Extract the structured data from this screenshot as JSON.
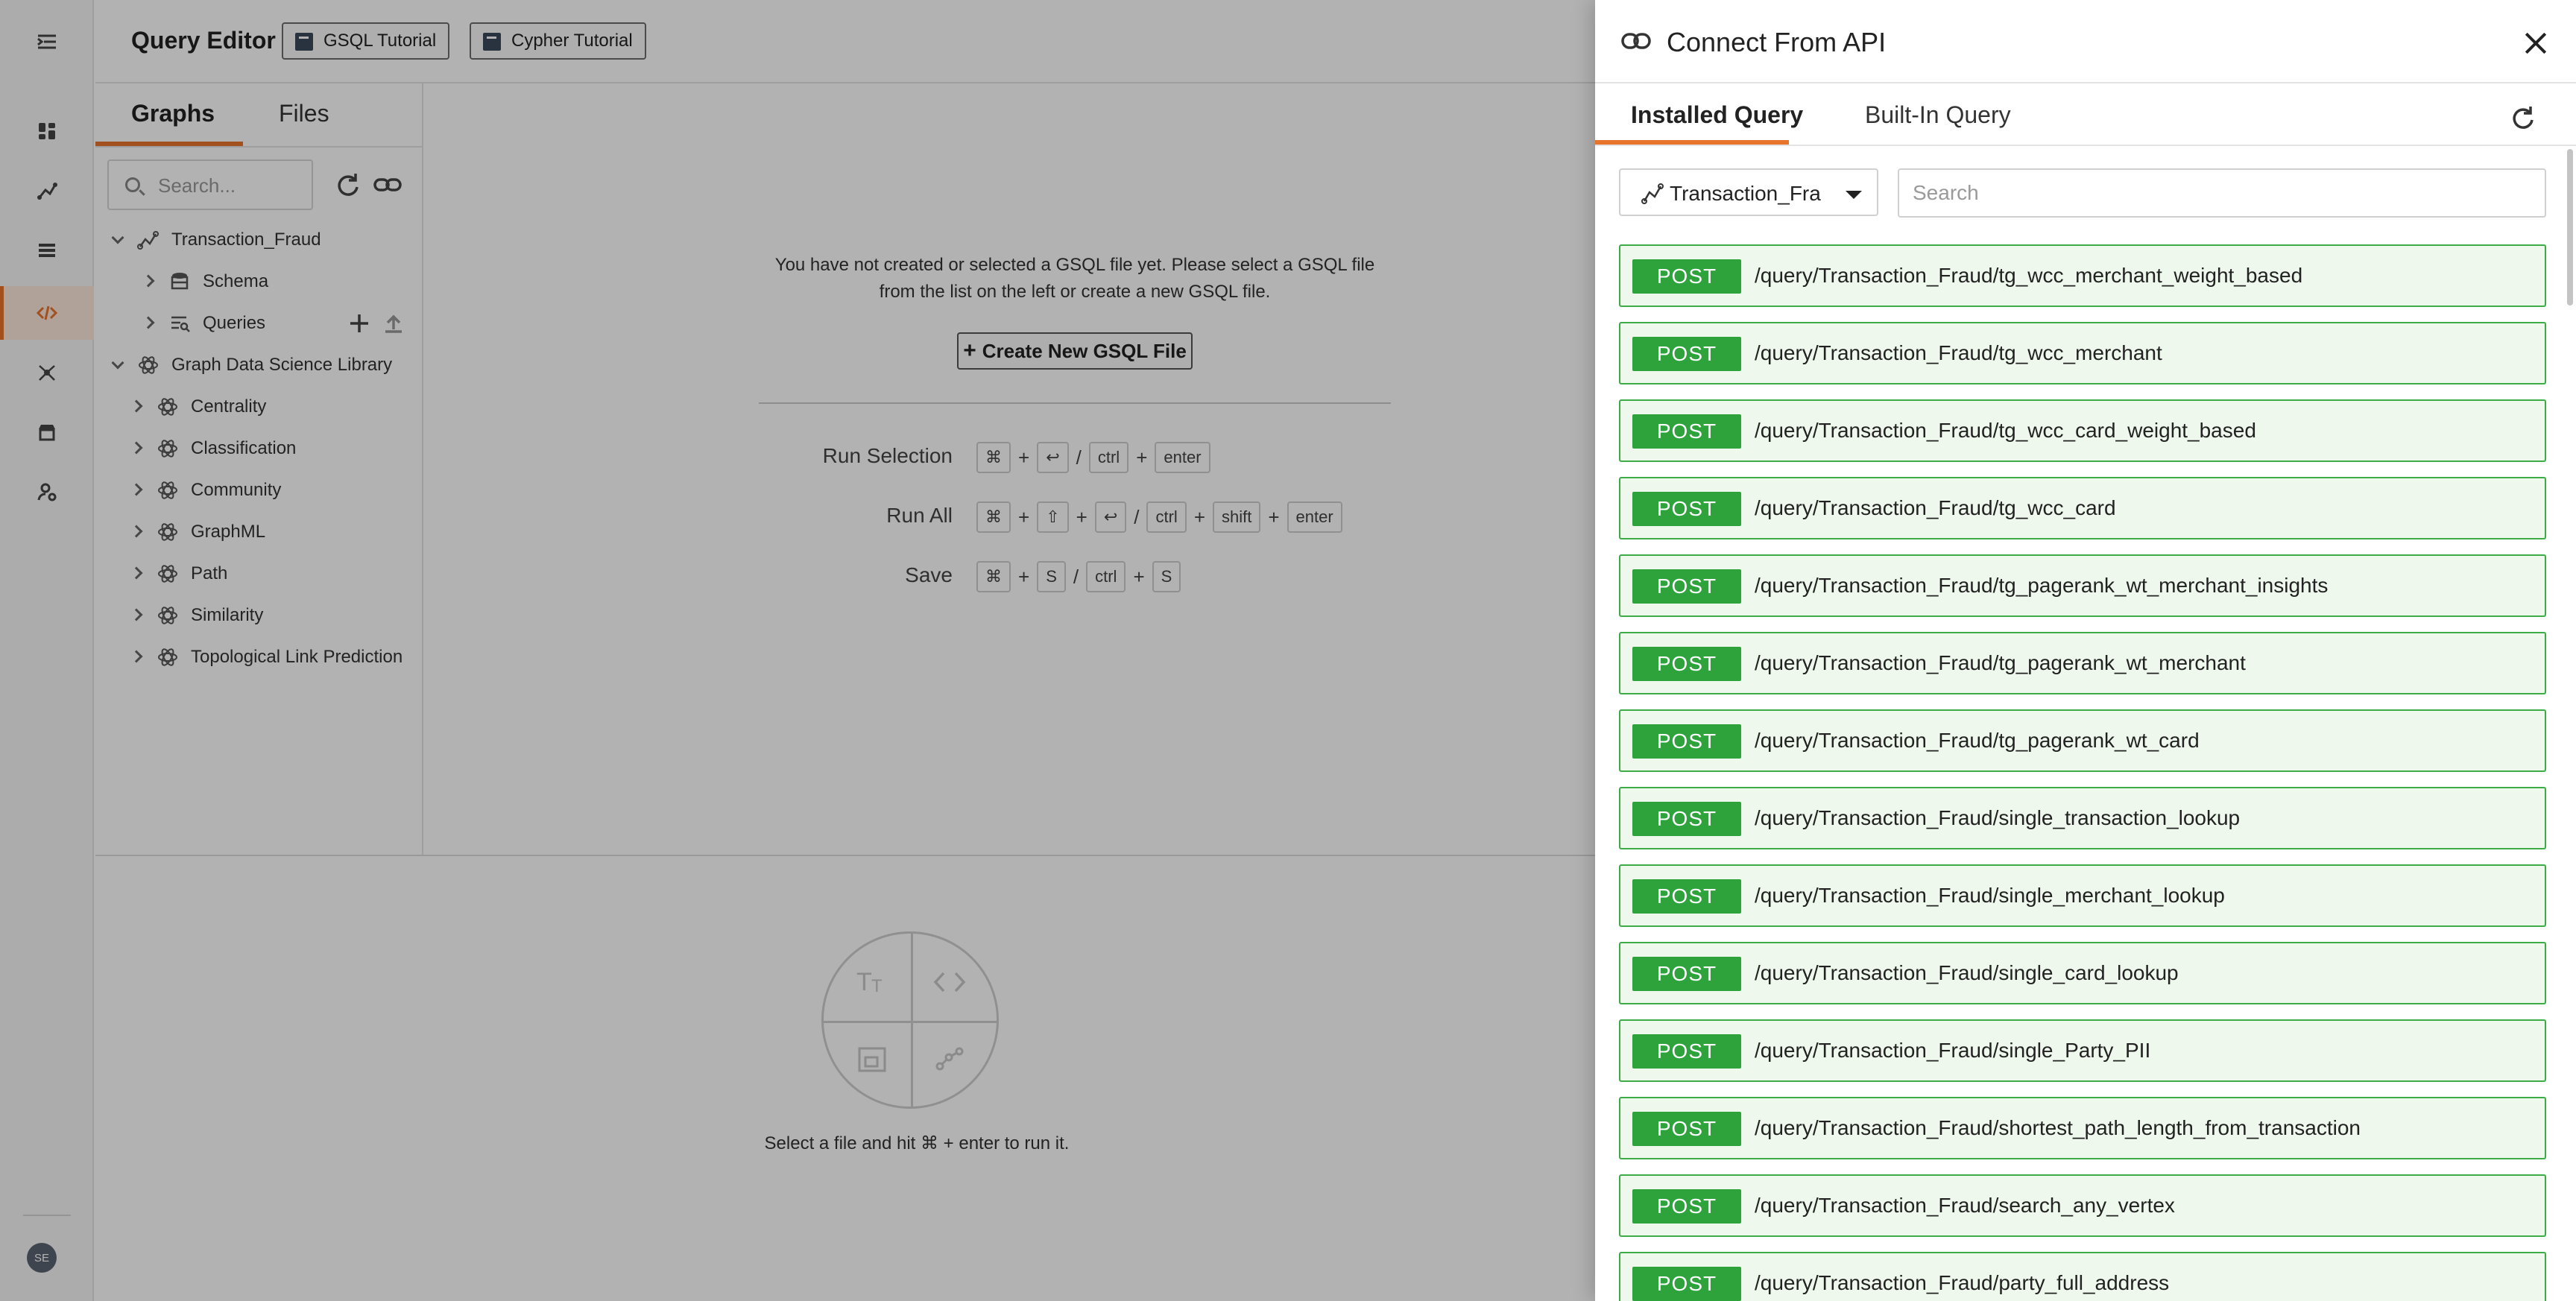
{
  "app": {
    "title": "Query Editor",
    "tutorials": [
      "GSQL Tutorial",
      "Cypher Tutorial"
    ],
    "avatar_initials": "SE"
  },
  "left_panel": {
    "tabs": [
      "Graphs",
      "Files"
    ],
    "active_tab": "Graphs",
    "search_placeholder": "Search...",
    "tree": {
      "graph": "Transaction_Fraud",
      "schema": "Schema",
      "queries": "Queries",
      "library": "Graph Data Science Library",
      "categories": [
        "Centrality",
        "Classification",
        "Community",
        "GraphML",
        "Path",
        "Similarity",
        "Topological Link Prediction"
      ]
    }
  },
  "editor": {
    "empty_message": "You have not created or selected a GSQL file yet. Please select a GSQL file from the list on the left or create a new GSQL file.",
    "create_button": "Create New GSQL File",
    "shortcuts": [
      {
        "label": "Run Selection",
        "keys": [
          "⌘",
          "+",
          "↩",
          "/",
          "ctrl",
          "+",
          "enter"
        ]
      },
      {
        "label": "Run All",
        "keys": [
          "⌘",
          "+",
          "⇧",
          "+",
          "↩",
          "/",
          "ctrl",
          "+",
          "shift",
          "+",
          "enter"
        ]
      },
      {
        "label": "Save",
        "keys": [
          "⌘",
          "+",
          "S",
          "/",
          "ctrl",
          "+",
          "S"
        ]
      }
    ]
  },
  "result_panel": {
    "hint": "Select a file and hit ⌘ + enter to run it."
  },
  "drawer": {
    "title": "Connect From API",
    "tabs": [
      "Installed Query",
      "Built-In Query"
    ],
    "active_tab": "Installed Query",
    "graph_select_value": "Transaction_Fra",
    "search_placeholder": "Search",
    "method_label": "POST",
    "queries": [
      "/query/Transaction_Fraud/tg_wcc_merchant_weight_based",
      "/query/Transaction_Fraud/tg_wcc_merchant",
      "/query/Transaction_Fraud/tg_wcc_card_weight_based",
      "/query/Transaction_Fraud/tg_wcc_card",
      "/query/Transaction_Fraud/tg_pagerank_wt_merchant_insights",
      "/query/Transaction_Fraud/tg_pagerank_wt_merchant",
      "/query/Transaction_Fraud/tg_pagerank_wt_card",
      "/query/Transaction_Fraud/single_transaction_lookup",
      "/query/Transaction_Fraud/single_merchant_lookup",
      "/query/Transaction_Fraud/single_card_lookup",
      "/query/Transaction_Fraud/single_Party_PII",
      "/query/Transaction_Fraud/shortest_path_length_from_transaction",
      "/query/Transaction_Fraud/search_any_vertex",
      "/query/Transaction_Fraud/party_full_address"
    ]
  },
  "colors": {
    "accent": "#e8742b",
    "post_badge": "#2ea33c",
    "row_border": "#3eac46",
    "row_bg": "#eef8ec"
  }
}
